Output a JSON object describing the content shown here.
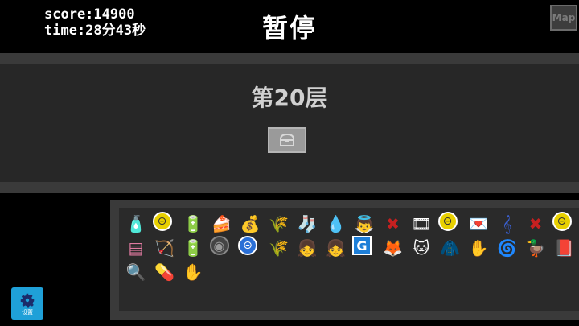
{
  "hud": {
    "score": "score:14900",
    "time": "time:28分43秒"
  },
  "title": "暂停",
  "map_button": "Map",
  "floor": "第20层",
  "settings_label": "设置",
  "items": [
    [
      "potion-bottle",
      "gold-coin",
      "battery",
      "cake-plate",
      "money-bag",
      "wheat",
      "black-stockings",
      "water-drops",
      "angel-figure",
      "red-tools",
      "film-strip",
      "gold-coin",
      "heart-envelope",
      "music-note",
      "red-tools",
      "gold-coin"
    ],
    [
      "pink-chest",
      "crossbow",
      "battery",
      "eye-disc",
      "blue-coin",
      "wheat",
      "pink-girl",
      "pink-girl",
      "blue-box",
      "orange-creature",
      "white-cat",
      "green-coat",
      "dark-claw",
      "red-spiral",
      "yellow-duck",
      "dark-book"
    ],
    [
      "magnifier",
      "red-pill",
      "dark-claw"
    ]
  ]
}
